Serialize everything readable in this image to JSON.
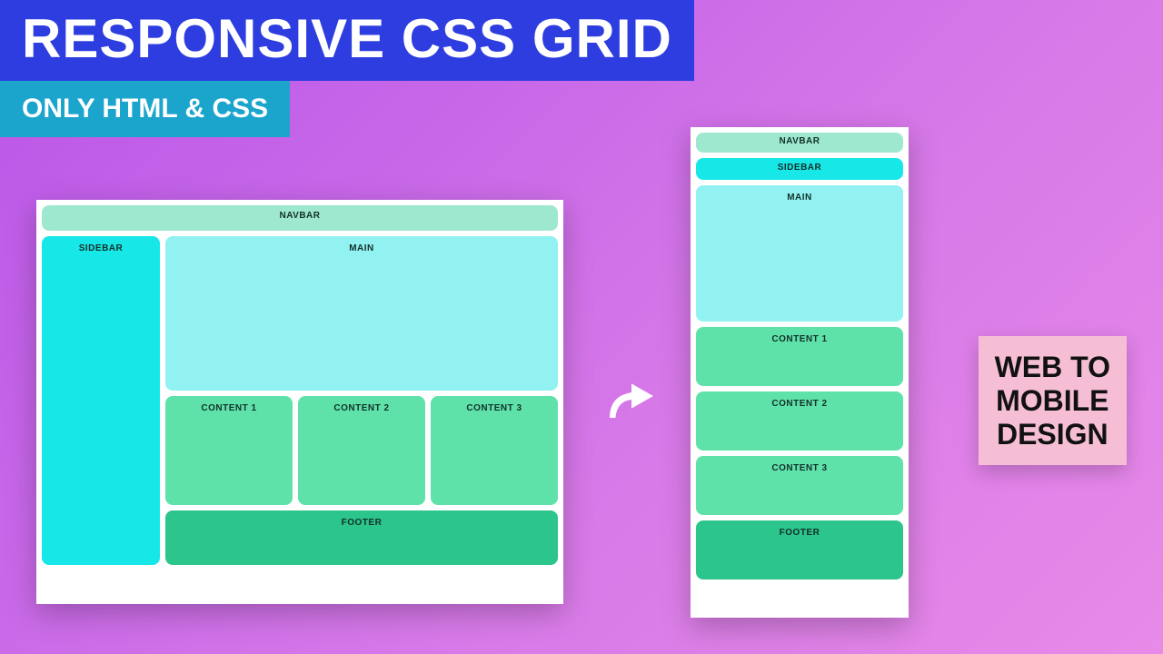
{
  "header": {
    "title": "RESPONSIVE CSS GRID",
    "subtitle": "ONLY HTML & CSS"
  },
  "desktop": {
    "navbar": "NAVBAR",
    "sidebar": "SIDEBAR",
    "main": "MAIN",
    "content1": "CONTENT 1",
    "content2": "CONTENT 2",
    "content3": "CONTENT 3",
    "footer": "FOOTER"
  },
  "mobile": {
    "navbar": "NAVBAR",
    "sidebar": "SIDEBAR",
    "main": "MAIN",
    "content1": "CONTENT 1",
    "content2": "CONTENT 2",
    "content3": "CONTENT 3",
    "footer": "FOOTER"
  },
  "side_label": {
    "line1": "WEB TO",
    "line2": "MOBILE",
    "line3": "DESIGN"
  },
  "colors": {
    "title_bg": "#2d3de0",
    "subtitle_bg": "#1ba5cc",
    "navbar": "#9ee8cf",
    "sidebar": "#18e7e7",
    "main": "#92f2f2",
    "content": "#5fe2aa",
    "footer": "#2cc58c",
    "side_label_bg": "#f5bed5"
  }
}
